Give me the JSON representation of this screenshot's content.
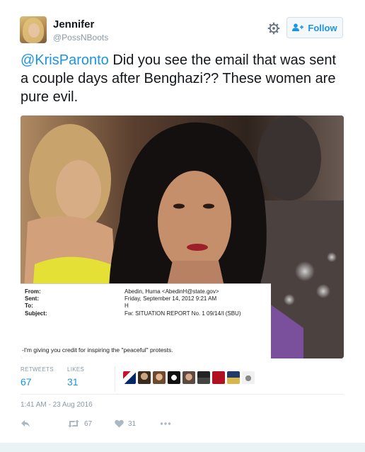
{
  "user": {
    "name": "Jennifer",
    "handle": "@PossNBoots"
  },
  "follow": {
    "label": "Follow"
  },
  "tweet": {
    "mention": "@KrisParonto",
    "text": " Did you see the email that was sent a couple days after Benghazi?? These women are pure evil."
  },
  "email": {
    "from_key": "From:",
    "from_val": "Abedin, Huma <AbedinH@state.gov>",
    "sent_key": "Sent:",
    "sent_val": "Friday, September 14, 2012 9:21 AM",
    "to_key": "To:",
    "to_val": "H",
    "subject_key": "Subject:",
    "subject_val": "Fw: SITUATION REPORT No. 1 09/14/I (SBU)",
    "body": "-I'm giving you credit for inspiring the \"peaceful\" protests."
  },
  "stats": {
    "retweets_label": "RETWEETS",
    "retweets_value": "67",
    "likes_label": "LIKES",
    "likes_value": "31"
  },
  "timestamp": "1:41 AM - 23 Aug 2016",
  "actions": {
    "retweet_count": "67",
    "like_count": "31"
  },
  "icons": [
    "gear-icon",
    "follow-person-icon",
    "reply-icon",
    "retweet-icon",
    "heart-icon",
    "more-icon"
  ],
  "colors": {
    "link": "#1b95e0",
    "muted": "#8899a6",
    "text": "#14171a"
  }
}
